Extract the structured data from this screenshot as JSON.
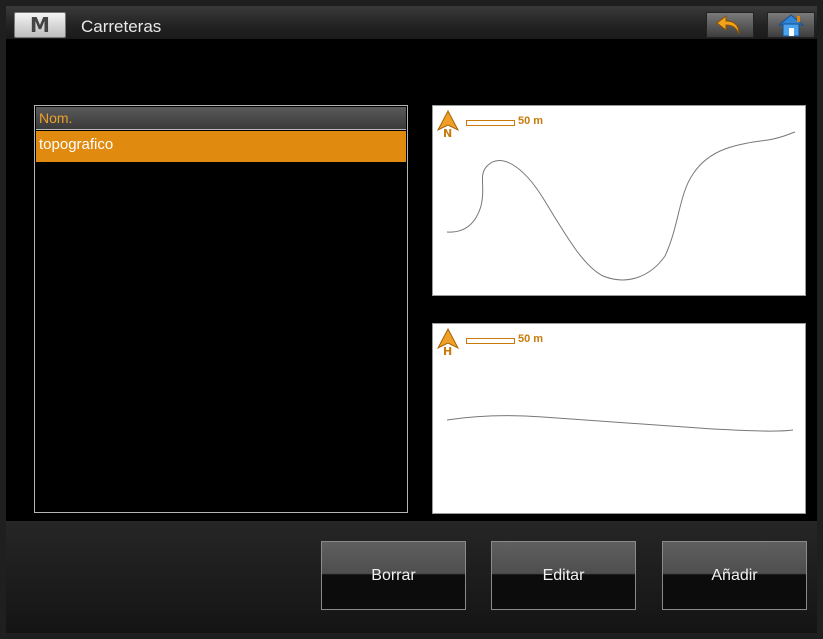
{
  "window": {
    "title": "Carreteras",
    "menu_letter": "M",
    "accent_color": "#e08a10"
  },
  "toolbar": {
    "back_icon": "back-arrow-icon",
    "home_icon": "home-icon"
  },
  "list": {
    "header": "Nom.",
    "items": [
      {
        "label": "topografico",
        "selected": true
      }
    ]
  },
  "plan_view": {
    "orientation_letter": "N",
    "scale_label": "50 m"
  },
  "profile_view": {
    "orientation_letter": "H",
    "scale_label": "50 m"
  },
  "actions": {
    "delete_label": "Borrar",
    "edit_label": "Editar",
    "add_label": "Añadir"
  }
}
